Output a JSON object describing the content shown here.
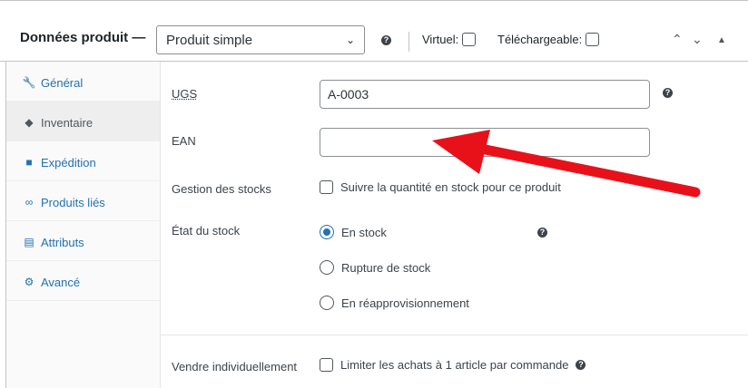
{
  "header": {
    "title": "Données produit —",
    "product_type": "Produit simple",
    "virtual_label": "Virtuel:",
    "downloadable_label": "Téléchargeable:",
    "help_icon": "help-icon",
    "chevron_up": "chevron-up-icon",
    "chevron_down": "chevron-down-icon",
    "toggle_up": "triangle-up-icon"
  },
  "sidebar": {
    "items": [
      {
        "label": "Général",
        "icon": "wrench-icon"
      },
      {
        "label": "Inventaire",
        "icon": "tag-icon"
      },
      {
        "label": "Expédition",
        "icon": "truck-icon"
      },
      {
        "label": "Produits liés",
        "icon": "link-icon"
      },
      {
        "label": "Attributs",
        "icon": "list-icon"
      },
      {
        "label": "Avancé",
        "icon": "gear-icon"
      }
    ],
    "active": "Inventaire"
  },
  "form": {
    "ugs_label": "UGS",
    "ugs_value": "A-0003",
    "ean_label": "EAN",
    "ean_value": "",
    "stock_management_label": "Gestion des stocks",
    "stock_management_text": "Suivre la quantité en stock pour ce produit",
    "stock_status_label": "État du stock",
    "stock_options": [
      "En stock",
      "Rupture de stock",
      "En réapprovisionnement"
    ],
    "stock_selected": "En stock",
    "sold_individually_label": "Vendre individuellement",
    "sold_individually_text": "Limiter les achats à 1 article par commande"
  },
  "colors": {
    "accent": "#2271b1",
    "annotation_arrow": "#e8111a"
  }
}
